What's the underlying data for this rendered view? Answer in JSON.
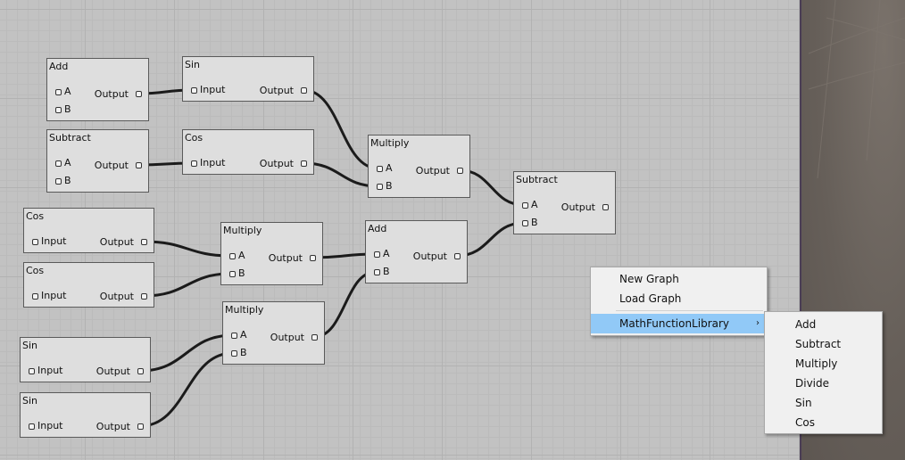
{
  "colors": {
    "canvas": "#c2c2c2",
    "node": "#dedede",
    "highlight": "#91c9f7",
    "side_panel": "#6b6560"
  },
  "nodes": [
    {
      "id": "n_add1",
      "title": "Add",
      "inputs": [
        "A",
        "B"
      ],
      "outputs": [
        "Output"
      ]
    },
    {
      "id": "n_sin1",
      "title": "Sin",
      "inputs": [
        "Input"
      ],
      "outputs": [
        "Output"
      ]
    },
    {
      "id": "n_sub1",
      "title": "Subtract",
      "inputs": [
        "A",
        "B"
      ],
      "outputs": [
        "Output"
      ]
    },
    {
      "id": "n_cos1",
      "title": "Cos",
      "inputs": [
        "Input"
      ],
      "outputs": [
        "Output"
      ]
    },
    {
      "id": "n_mul1",
      "title": "Multiply",
      "inputs": [
        "A",
        "B"
      ],
      "outputs": [
        "Output"
      ]
    },
    {
      "id": "n_sub2",
      "title": "Subtract",
      "inputs": [
        "A",
        "B"
      ],
      "outputs": [
        "Output"
      ]
    },
    {
      "id": "n_cos2",
      "title": "Cos",
      "inputs": [
        "Input"
      ],
      "outputs": [
        "Output"
      ]
    },
    {
      "id": "n_cos3",
      "title": "Cos",
      "inputs": [
        "Input"
      ],
      "outputs": [
        "Output"
      ]
    },
    {
      "id": "n_mul2",
      "title": "Multiply",
      "inputs": [
        "A",
        "B"
      ],
      "outputs": [
        "Output"
      ]
    },
    {
      "id": "n_add2",
      "title": "Add",
      "inputs": [
        "A",
        "B"
      ],
      "outputs": [
        "Output"
      ]
    },
    {
      "id": "n_mul3",
      "title": "Multiply",
      "inputs": [
        "A",
        "B"
      ],
      "outputs": [
        "Output"
      ]
    },
    {
      "id": "n_sin2",
      "title": "Sin",
      "inputs": [
        "Input"
      ],
      "outputs": [
        "Output"
      ]
    },
    {
      "id": "n_sin3",
      "title": "Sin",
      "inputs": [
        "Input"
      ],
      "outputs": [
        "Output"
      ]
    }
  ],
  "connections": [
    {
      "from": "n_add1.Output",
      "to": "n_sin1.Input"
    },
    {
      "from": "n_sub1.Output",
      "to": "n_cos1.Input"
    },
    {
      "from": "n_sin1.Output",
      "to": "n_mul1.A"
    },
    {
      "from": "n_cos1.Output",
      "to": "n_mul1.B"
    },
    {
      "from": "n_mul1.Output",
      "to": "n_sub2.A"
    },
    {
      "from": "n_add2.Output",
      "to": "n_sub2.B"
    },
    {
      "from": "n_cos2.Output",
      "to": "n_mul2.A"
    },
    {
      "from": "n_cos3.Output",
      "to": "n_mul2.B"
    },
    {
      "from": "n_mul2.Output",
      "to": "n_add2.A"
    },
    {
      "from": "n_mul3.Output",
      "to": "n_add2.B"
    },
    {
      "from": "n_sin2.Output",
      "to": "n_mul3.A"
    },
    {
      "from": "n_sin3.Output",
      "to": "n_mul3.B"
    }
  ],
  "context_menu": {
    "items": [
      {
        "label": "New Graph"
      },
      {
        "label": "Load Graph"
      },
      {
        "label": "MathFunctionLibrary",
        "submenu_arrow": "›",
        "highlighted": true
      }
    ]
  },
  "submenu": {
    "items": [
      {
        "label": "Add"
      },
      {
        "label": "Subtract"
      },
      {
        "label": "Multiply"
      },
      {
        "label": "Divide"
      },
      {
        "label": "Sin"
      },
      {
        "label": "Cos"
      }
    ]
  }
}
